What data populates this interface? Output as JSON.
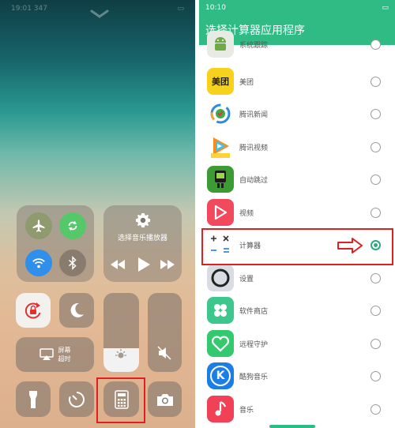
{
  "left_panel": {
    "status_time": "19:01 347",
    "music_module": {
      "label": "选择音乐播放器"
    },
    "screen_mirror": {
      "label_line1": "屏幕",
      "label_line2": "超时"
    },
    "brightness_level": 0.3
  },
  "right_panel": {
    "status_time": "10:10",
    "title": "选择计算器应用程序",
    "accent_color": "#30bb85",
    "apps": [
      {
        "name": "系统跟踪",
        "icon": "android-icon",
        "selected": false
      },
      {
        "name": "美团",
        "icon": "meituan-icon",
        "icon_text": "美团",
        "selected": false
      },
      {
        "name": "腾讯新闻",
        "icon": "tencent-news-icon",
        "selected": false
      },
      {
        "name": "腾讯视频",
        "icon": "tencent-video-icon",
        "selected": false
      },
      {
        "name": "自动跳过",
        "icon": "auto-skip-icon",
        "selected": false
      },
      {
        "name": "视频",
        "icon": "video-icon",
        "selected": false
      },
      {
        "name": "计算器",
        "icon": "calculator-icon",
        "selected": true
      },
      {
        "name": "设置",
        "icon": "settings-icon",
        "selected": false
      },
      {
        "name": "软件商店",
        "icon": "app-store-icon",
        "selected": false
      },
      {
        "name": "远程守护",
        "icon": "remote-guard-icon",
        "selected": false
      },
      {
        "name": "酷狗音乐",
        "icon": "kugou-music-icon",
        "icon_text": "K",
        "selected": false
      },
      {
        "name": "音乐",
        "icon": "music-icon",
        "selected": false
      }
    ]
  }
}
